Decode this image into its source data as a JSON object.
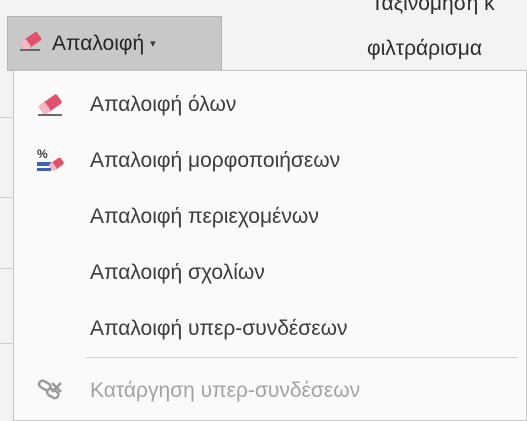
{
  "ribbon": {
    "button_label": "Απαλοιφή",
    "caret": "▾",
    "side_text_line1": "Ταξινόμηση κ",
    "side_text_line2": "φιλτράρισμα"
  },
  "menu": {
    "items": [
      {
        "label": "Απαλοιφή όλων",
        "icon": "eraser-icon"
      },
      {
        "label": "Απαλοιφή μορφοποιήσεων",
        "icon": "clear-formats-icon"
      },
      {
        "label": "Απαλοιφή περιεχομένων",
        "icon": ""
      },
      {
        "label": "Απαλοιφή σχολίων",
        "icon": ""
      },
      {
        "label": "Απαλοιφή υπερ-συνδέσεων",
        "icon": ""
      },
      {
        "label": "Κατάργηση υπερ-συνδέσεων",
        "icon": "remove-hyperlink-icon",
        "disabled": true
      }
    ]
  },
  "colors": {
    "eraser_pink": "#e2506a",
    "disabled_text": "#a3a3a3",
    "button_bg": "#c8c8c8"
  }
}
